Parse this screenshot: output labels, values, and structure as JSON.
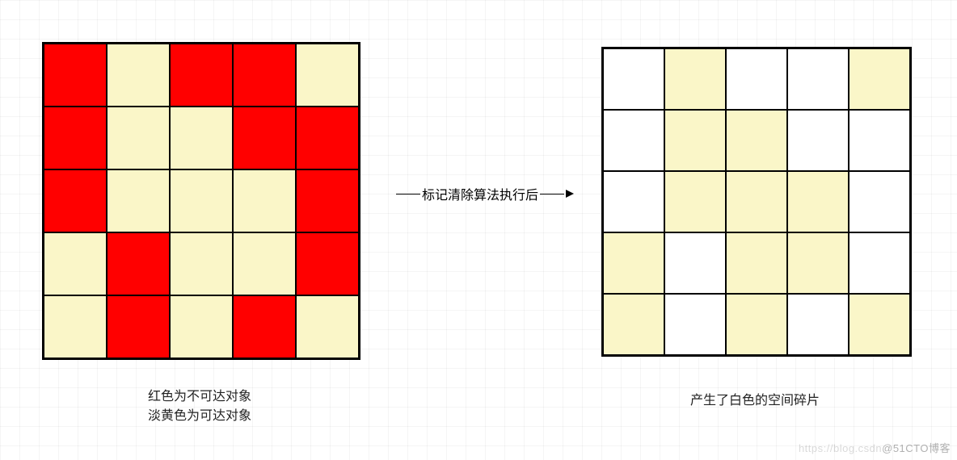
{
  "colors": {
    "unreachable": "#ff0000",
    "reachable": "#faf6c8",
    "fragment": "#ffffff",
    "grid_border": "#000000"
  },
  "legend": {
    "red": "红色为不可达对象",
    "yellow": "淡黄色为可达对象"
  },
  "arrow_label": "标记清除算法执行后",
  "caption_left_line1": "红色为不可达对象",
  "caption_left_line2": "淡黄色为可达对象",
  "caption_right": "产生了白色的空间碎片",
  "watermark_faint": "https://blog.csdn",
  "watermark": "@51CTO博客",
  "grid_left": {
    "rows": 5,
    "cols": 5,
    "cells": [
      [
        "red",
        "yellow",
        "red",
        "red",
        "yellow"
      ],
      [
        "red",
        "yellow",
        "yellow",
        "red",
        "red"
      ],
      [
        "red",
        "yellow",
        "yellow",
        "yellow",
        "red"
      ],
      [
        "yellow",
        "red",
        "yellow",
        "yellow",
        "red"
      ],
      [
        "yellow",
        "red",
        "yellow",
        "red",
        "yellow"
      ]
    ]
  },
  "grid_right": {
    "rows": 5,
    "cols": 5,
    "cells": [
      [
        "white",
        "yellow",
        "white",
        "white",
        "yellow"
      ],
      [
        "white",
        "yellow",
        "yellow",
        "white",
        "white"
      ],
      [
        "white",
        "yellow",
        "yellow",
        "yellow",
        "white"
      ],
      [
        "yellow",
        "white",
        "yellow",
        "yellow",
        "white"
      ],
      [
        "yellow",
        "white",
        "yellow",
        "white",
        "yellow"
      ]
    ]
  }
}
